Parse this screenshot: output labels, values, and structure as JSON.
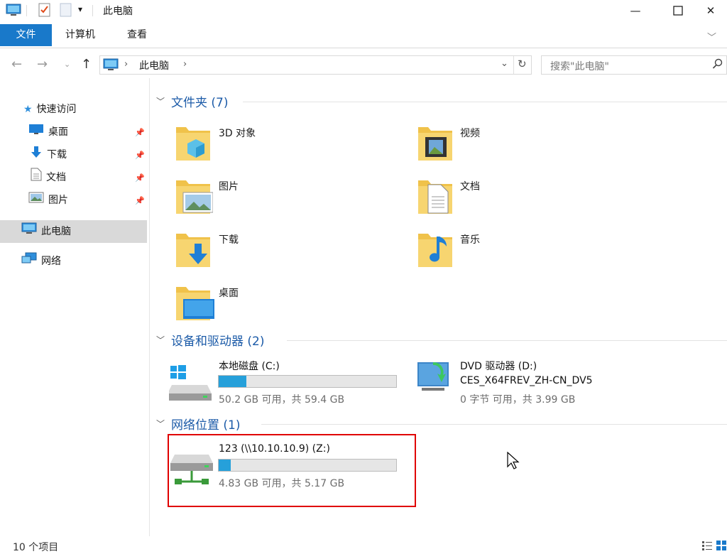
{
  "window": {
    "title": "此电脑",
    "quick_access": [
      "computer-icon",
      "properties-check-icon",
      "new-folder-icon",
      "customize-dropdown-icon"
    ],
    "controls": [
      "minimize-icon",
      "maximize-icon",
      "close-icon"
    ]
  },
  "ribbon": {
    "tabs": [
      {
        "label": "文件",
        "active": true
      },
      {
        "label": "计算机",
        "active": false
      },
      {
        "label": "查看",
        "active": false
      }
    ],
    "accent": "#1979ca"
  },
  "address": {
    "crumbs": [
      "此电脑"
    ],
    "search_placeholder": "搜索\"此电脑\""
  },
  "nav": {
    "quick_access": "快速访问",
    "pinned": [
      {
        "label": "桌面",
        "icon": "desktop-icon"
      },
      {
        "label": "下载",
        "icon": "download-arrow-icon"
      },
      {
        "label": "文档",
        "icon": "document-icon"
      },
      {
        "label": "图片",
        "icon": "picture-icon"
      }
    ],
    "this_pc": "此电脑",
    "network": "网络"
  },
  "groups": {
    "folders": {
      "header": "文件夹 (7)",
      "items": [
        {
          "label": "3D 对象",
          "icon": "3d-objects-folder-icon"
        },
        {
          "label": "视频",
          "icon": "videos-folder-icon"
        },
        {
          "label": "图片",
          "icon": "pictures-folder-icon"
        },
        {
          "label": "文档",
          "icon": "documents-folder-icon"
        },
        {
          "label": "下载",
          "icon": "downloads-folder-icon"
        },
        {
          "label": "音乐",
          "icon": "music-folder-icon"
        },
        {
          "label": "桌面",
          "icon": "desktop-folder-icon"
        }
      ]
    },
    "devices": {
      "header": "设备和驱动器 (2)",
      "items": [
        {
          "name": "本地磁盘 (C:)",
          "sub": "50.2 GB 可用，共 59.4 GB",
          "used_fraction": 0.155,
          "icon": "windows-drive-icon"
        },
        {
          "name": "DVD 驱动器 (D:)",
          "name2": "CES_X64FREV_ZH-CN_DV5",
          "sub": "0 字节 可用，共 3.99 GB",
          "icon": "dvd-drive-icon"
        }
      ]
    },
    "network": {
      "header": "网络位置 (1)",
      "items": [
        {
          "name": "123 (\\\\10.10.10.9) (Z:)",
          "sub": "4.83 GB 可用，共 5.17 GB",
          "used_fraction": 0.066,
          "icon": "network-drive-icon"
        }
      ]
    }
  },
  "status": {
    "count": "10 个项目"
  },
  "colors": {
    "bar_fill": "#26a0da",
    "highlight": "#e00000",
    "group_header": "#1c5ba8",
    "selection": "#d9d9d9"
  }
}
